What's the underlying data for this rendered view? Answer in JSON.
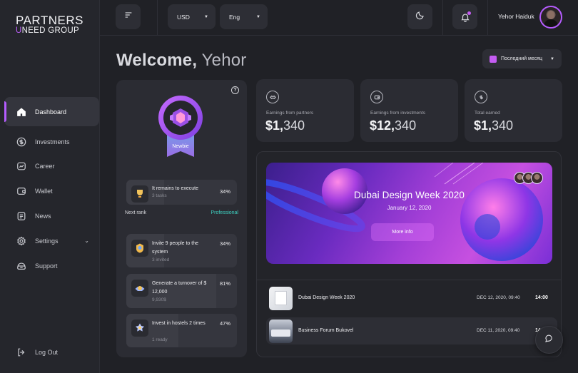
{
  "brand": {
    "line1": "PARTNERS",
    "line2_accent": "U",
    "line2_rest": "NEED GROUP"
  },
  "sidebar": {
    "items": [
      {
        "label": "Dashboard",
        "icon": "home-icon",
        "active": true
      },
      {
        "label": "Investments",
        "icon": "dollar-circle-icon"
      },
      {
        "label": "Career",
        "icon": "career-icon"
      },
      {
        "label": "Wallet",
        "icon": "wallet-icon"
      },
      {
        "label": "News",
        "icon": "news-icon"
      },
      {
        "label": "Settings",
        "icon": "settings-icon",
        "expandable": true
      },
      {
        "label": "Support",
        "icon": "support-icon"
      }
    ],
    "logout": "Log Out"
  },
  "topbar": {
    "currency": "USD",
    "language": "Eng",
    "user_name": "Yehor Haiduk",
    "notification_dot_color": "#c45cf2"
  },
  "welcome": {
    "greeting": "Welcome,",
    "name": "Yehor"
  },
  "period_select": "Последний месяц",
  "rank": {
    "badge_label": "Newbie",
    "current_task": {
      "title": "It remains to execute",
      "sub": "3 tasks",
      "percent": "34%",
      "progress": 0.34
    },
    "next_rank_label": "Next rank",
    "next_rank_value": "Professional",
    "tasks": [
      {
        "title": "Invite 9 people to the system",
        "sub": "3 invited",
        "percent": "34%",
        "progress": 0.34
      },
      {
        "title": "Generate a turnover of $ 12,000",
        "sub": "9,930$",
        "percent": "81%",
        "progress": 0.81
      },
      {
        "title": "Invest in hostels 2 times",
        "sub": "1 ready",
        "percent": "47%",
        "progress": 0.47
      }
    ]
  },
  "stats": [
    {
      "label": "Earnings from partners",
      "currency": "$",
      "whole": "1,",
      "rest": "340"
    },
    {
      "label": "Earnings from investments",
      "currency": "$",
      "whole": "12,",
      "rest": "340"
    },
    {
      "label": "Total earned",
      "currency": "$",
      "whole": "1,",
      "rest": "340"
    }
  ],
  "featured_event": {
    "title": "Dubai Design Week 2020",
    "date": "January 12, 2020",
    "button": "More info"
  },
  "events": [
    {
      "name": "Dubai Design Week 2020",
      "date": "DEC 12, 2020, 09:40",
      "time": "14:00"
    },
    {
      "name": "Business Forum Bukovel",
      "date": "DEC 11, 2020, 09:40",
      "time": "14"
    }
  ],
  "colors": {
    "accent": "#b55cff",
    "teal": "#3ed0c0",
    "background": "#202126",
    "card": "#2b2c33"
  }
}
